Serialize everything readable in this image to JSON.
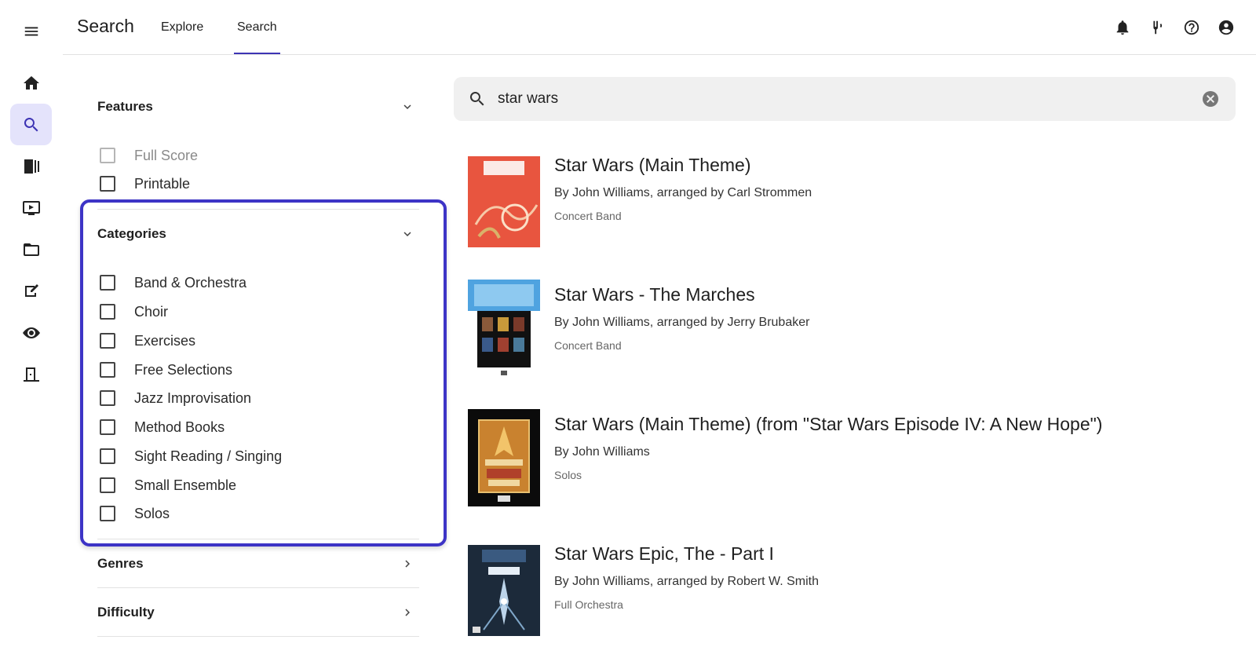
{
  "header": {
    "title": "Search",
    "tabs": [
      {
        "label": "Explore",
        "active": false
      },
      {
        "label": "Search",
        "active": true
      }
    ],
    "icons": [
      "bell-icon",
      "tuning-fork-icon",
      "help-icon",
      "account-icon"
    ]
  },
  "rail": {
    "items": [
      "home-icon",
      "search-icon",
      "library-icon",
      "video-icon",
      "folder-icon",
      "assignment-icon",
      "ear-training-icon",
      "exit-icon"
    ],
    "active": "search-icon"
  },
  "filters": {
    "features": {
      "title": "Features",
      "options": [
        {
          "label": "Full Score",
          "disabled": true
        },
        {
          "label": "Printable",
          "disabled": false
        }
      ]
    },
    "categories": {
      "title": "Categories",
      "options": [
        "Band & Orchestra",
        "Choir",
        "Exercises",
        "Free Selections",
        "Jazz Improvisation",
        "Method Books",
        "Sight Reading / Singing",
        "Small Ensemble",
        "Solos"
      ]
    },
    "genres": {
      "title": "Genres"
    },
    "difficulty": {
      "title": "Difficulty"
    }
  },
  "search": {
    "value": "star wars"
  },
  "results": [
    {
      "title": "Star Wars (Main Theme)",
      "author": "By John Williams, arranged by Carl Strommen",
      "category": "Concert Band"
    },
    {
      "title": "Star Wars - The Marches",
      "author": "By John Williams, arranged by Jerry Brubaker",
      "category": "Concert Band"
    },
    {
      "title": "Star Wars (Main Theme) (from \"Star Wars Episode IV: A New Hope\")",
      "author": "By John Williams",
      "category": "Solos"
    },
    {
      "title": "Star Wars Epic, The - Part I",
      "author": "By John Williams, arranged by Robert W. Smith",
      "category": "Full Orchestra"
    }
  ],
  "colors": {
    "accent": "#3d34b4",
    "highlight": "#3d34c6",
    "search_bg": "#f0f0f0"
  }
}
